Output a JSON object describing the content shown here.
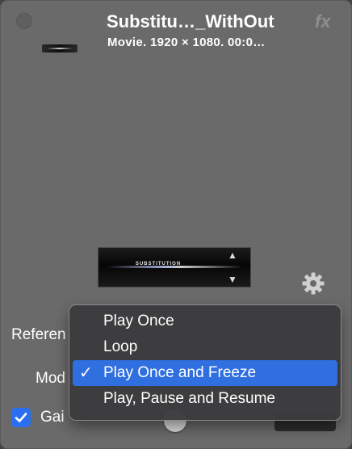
{
  "header": {
    "title": "Substitu…_WithOut",
    "fx_label": "fx",
    "subtitle": "Movie. 1920 × 1080. 00:0…"
  },
  "preview": {
    "text": "SUBSTITUTION"
  },
  "form": {
    "reference_label": "Referen",
    "mode_label": "Mod",
    "gain_label": "Gai",
    "gain_checked": true
  },
  "menu": {
    "items": [
      {
        "label": "Play Once",
        "checked": false
      },
      {
        "label": "Loop",
        "checked": false
      },
      {
        "label": "Play Once and Freeze",
        "checked": true
      },
      {
        "label": "Play, Pause and Resume",
        "checked": false
      }
    ],
    "check_glyph": "✓"
  },
  "icons": {
    "close": "close-dot-icon",
    "settings": "gear-icon",
    "checkbox": "checkmark-icon"
  },
  "colors": {
    "panel_bg": "#6a6a6a",
    "menu_bg": "#3c3c3e",
    "selection": "#2f6fe0",
    "checkbox": "#2a6ff0"
  }
}
